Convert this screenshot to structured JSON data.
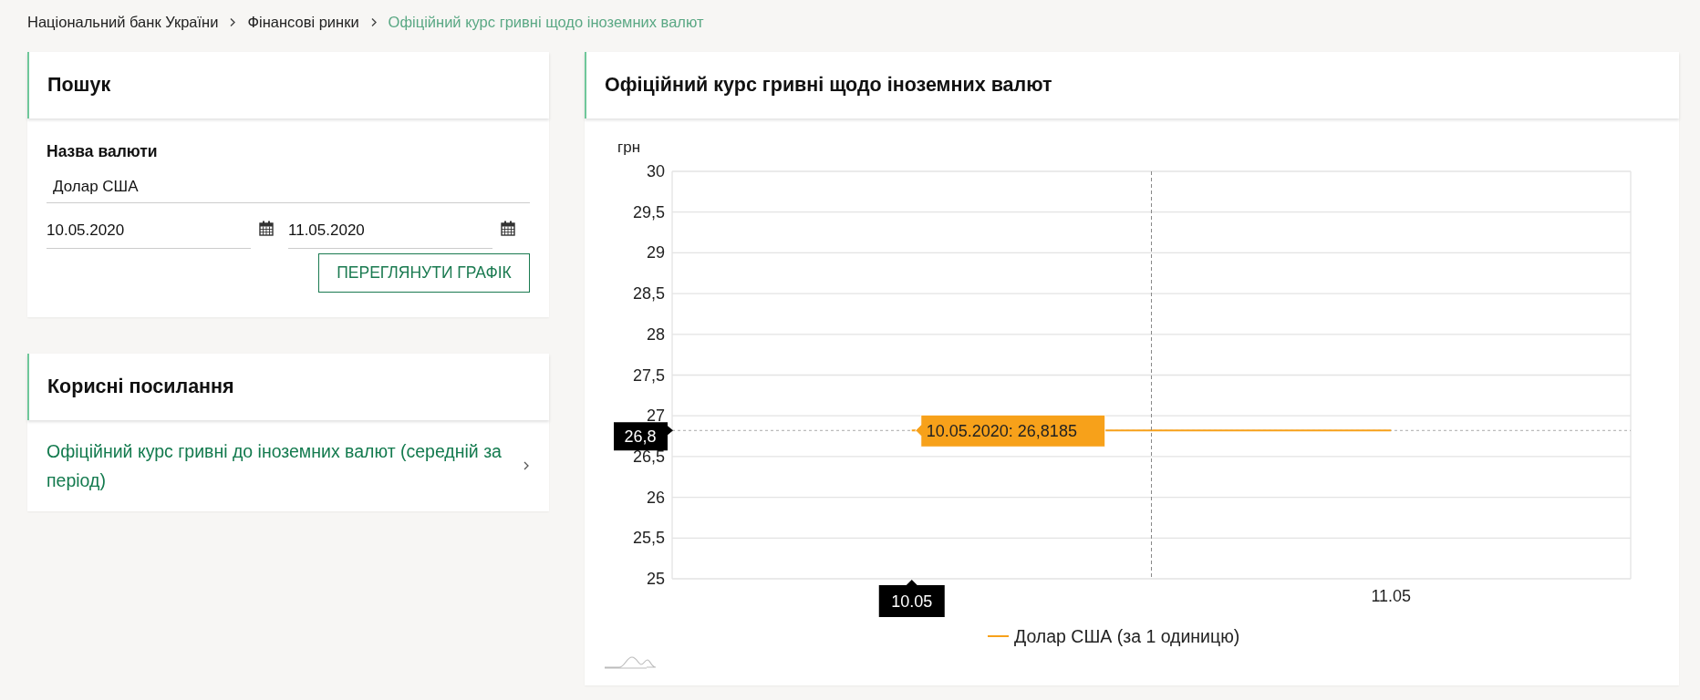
{
  "breadcrumb": [
    {
      "label": "Національний банк України",
      "current": false
    },
    {
      "label": "Фінансові ринки",
      "current": false
    },
    {
      "label": "Офіційний курс гривні щодо іноземних валют",
      "current": true
    }
  ],
  "search": {
    "title": "Пошук",
    "currency_label": "Назва валюти",
    "currency": "Долар США",
    "date_from": "10.05.2020",
    "date_to": "11.05.2020",
    "button": "ПЕРЕГЛЯНУТИ ГРАФІК"
  },
  "links": {
    "title": "Корисні посилання",
    "items": [
      "Офіційний курс гривні до іноземних валют (середній за період)"
    ]
  },
  "chart_panel": {
    "title": "Офіційний курс гривні щодо іноземних валют",
    "chart_data": {
      "type": "line",
      "ylabel": "грн",
      "categories": [
        "10.05",
        "11.05"
      ],
      "series": [
        {
          "name": "Долар США (за 1 одиницю)",
          "color": "#f7a11a",
          "values": [
            26.82,
            26.82
          ]
        }
      ],
      "grid": true,
      "ref_lines": [
        {
          "axis": "y",
          "value": 26.82
        }
      ],
      "ylim": [
        25,
        30
      ],
      "yticks": [
        {
          "value": 25,
          "label": "25"
        },
        {
          "value": 25.5,
          "label": "25,5"
        },
        {
          "value": 26,
          "label": "26"
        },
        {
          "value": 26.5,
          "label": "26,5"
        },
        {
          "value": 27,
          "label": "27"
        },
        {
          "value": 27.5,
          "label": "27,5"
        },
        {
          "value": 28,
          "label": "28"
        },
        {
          "value": 28.5,
          "label": "28,5"
        },
        {
          "value": 29,
          "label": "29"
        },
        {
          "value": 29.5,
          "label": "29,5"
        },
        {
          "value": 30,
          "label": "30"
        }
      ]
    },
    "tooltip": "10.05.2020: 26,8185",
    "crosshair_y_label": "26,8",
    "crosshair_x_label": "10.05"
  }
}
